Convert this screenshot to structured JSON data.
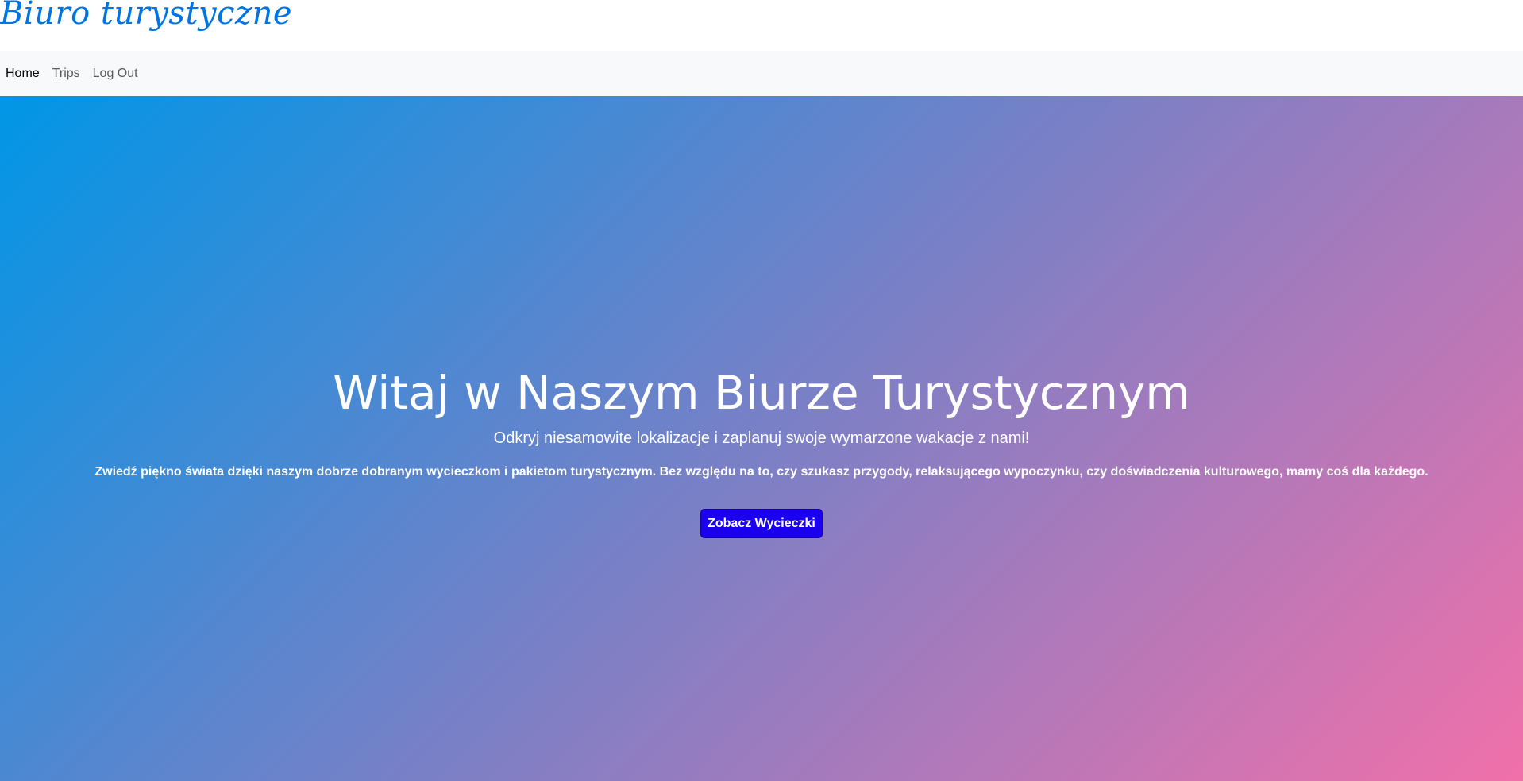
{
  "brand": {
    "title": "Biuro turystyczne",
    "color": "#0074e0"
  },
  "nav": {
    "items": [
      {
        "label": "Home",
        "active": true
      },
      {
        "label": "Trips",
        "active": false
      },
      {
        "label": "Log Out",
        "active": false
      }
    ]
  },
  "hero": {
    "title": "Witaj w Naszym Biurze Turystycznym",
    "subtitle": "Odkryj niesamowite lokalizacje i zaplanuj swoje wymarzone wakacje z nami!",
    "text": "Zwiedź piękno świata dzięki naszym dobrze dobranym wycieczkom i pakietom turystycznym. Bez względu na to, czy szukasz przygody, relaksującego wypoczynku, czy doświadczenia kulturowego, mamy coś dla każdego.",
    "button_label": "Zobacz Wycieczki",
    "gradient_colors": [
      "#0096e6",
      "#7a80c6",
      "#f170aa"
    ],
    "button_color": "#1b00f0"
  }
}
